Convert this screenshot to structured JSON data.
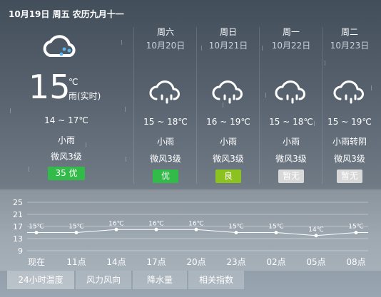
{
  "today": {
    "date_line": "10月19日 周五 农历九月十一",
    "temperature": "15",
    "unit": "℃",
    "description": "雨(实时)",
    "range": "14 ~ 17℃",
    "weather": "小雨",
    "wind": "微风3级",
    "aqi": "35  优",
    "icon": "cloud-rain-icon"
  },
  "forecast": [
    {
      "day": "周六",
      "date": "10月20日",
      "range": "15 ~ 18℃",
      "weather": "小雨",
      "wind": "微风3级",
      "aqi": "优",
      "aqi_color": "#33bb4a",
      "icon": "cloud-rain-icon"
    },
    {
      "day": "周日",
      "date": "10月21日",
      "range": "16 ~ 19℃",
      "weather": "小雨",
      "wind": "微风3级",
      "aqi": "良",
      "aqi_color": "#8cc21f",
      "icon": "cloud-rain-icon"
    },
    {
      "day": "周一",
      "date": "10月22日",
      "range": "15 ~ 18℃",
      "weather": "小雨",
      "wind": "微风3级",
      "aqi": "暂无",
      "aqi_color": "#d8d8d8",
      "icon": "cloud-rain-icon"
    },
    {
      "day": "周二",
      "date": "10月23日",
      "range": "15 ~ 19℃",
      "weather": "小雨转阴",
      "wind": "微风3级",
      "aqi": "暂无",
      "aqi_color": "#d8d8d8",
      "icon": "cloud-rain-icon"
    }
  ],
  "chart_data": {
    "type": "line",
    "x": [
      "现在",
      "11点",
      "14点",
      "17点",
      "20点",
      "23点",
      "02点",
      "05点",
      "08点"
    ],
    "series": [
      {
        "values": [
          15,
          15,
          16,
          16,
          16,
          15,
          15,
          14,
          15
        ]
      }
    ],
    "data_labels": [
      "15℃",
      "15℃",
      "16℃",
      "16℃",
      "16℃",
      "15℃",
      "15℃",
      "14℃",
      "15℃"
    ],
    "y_ticks": [
      "25",
      "21",
      "17",
      "13",
      "9"
    ],
    "ylim": [
      9,
      25
    ],
    "grid": true,
    "line_color": "#ffffff"
  },
  "tabs": [
    {
      "label": "24小时温度",
      "active": true
    },
    {
      "label": "风力风向",
      "active": false
    },
    {
      "label": "降水量",
      "active": false
    },
    {
      "label": "相关指数",
      "active": false
    }
  ]
}
